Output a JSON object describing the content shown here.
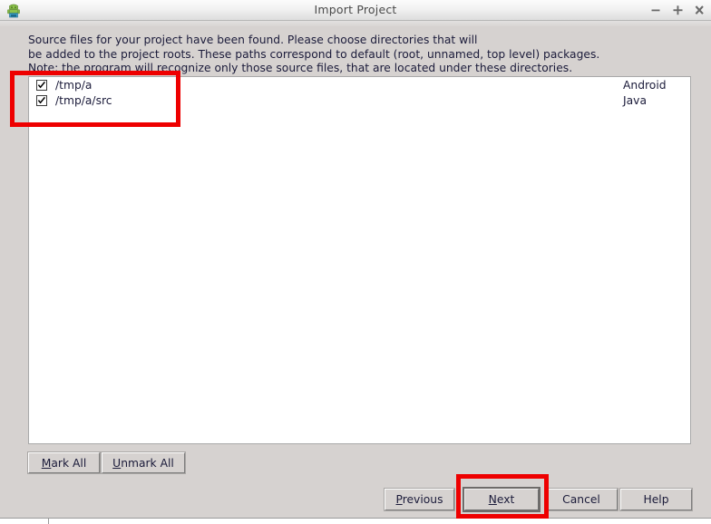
{
  "window": {
    "title": "Import Project",
    "icon": "android-robot-icon",
    "controls": [
      {
        "name": "minimize-button",
        "glyph": "−"
      },
      {
        "name": "maximize-button",
        "glyph": "+"
      },
      {
        "name": "close-button",
        "glyph": "✖"
      }
    ]
  },
  "instructions": {
    "line1": "Source files for your project have been found. Please choose directories that will",
    "line2": "be added to the project roots. These paths correspond to default (root, unnamed, top level) packages.",
    "line3": "Note: the program will recognize only those source files, that are located under these directories."
  },
  "list": {
    "rows": [
      {
        "path": "/tmp/a",
        "type": "Android",
        "checked": true
      },
      {
        "path": "/tmp/a/src",
        "type": "Java",
        "checked": true
      }
    ]
  },
  "buttons": {
    "mark_all": {
      "prefix": "",
      "mnemonic": "M",
      "suffix": "ark All"
    },
    "unmark_all": {
      "prefix": "",
      "mnemonic": "U",
      "suffix": "nmark All"
    },
    "previous": {
      "prefix": "",
      "mnemonic": "P",
      "suffix": "revious"
    },
    "next": {
      "prefix": "",
      "mnemonic": "N",
      "suffix": "ext"
    },
    "cancel": {
      "label": "Cancel"
    },
    "help": {
      "label": "Help"
    }
  },
  "annotations": {
    "color": "#ee0000",
    "boxes": [
      "source-directories-list",
      "next-button"
    ]
  },
  "colors": {
    "dialog_background": "#d6d2d0",
    "list_background": "#ffffff",
    "text": "#1b1b3a",
    "title_text": "#4a4a4a",
    "highlight": "#ee0000"
  }
}
